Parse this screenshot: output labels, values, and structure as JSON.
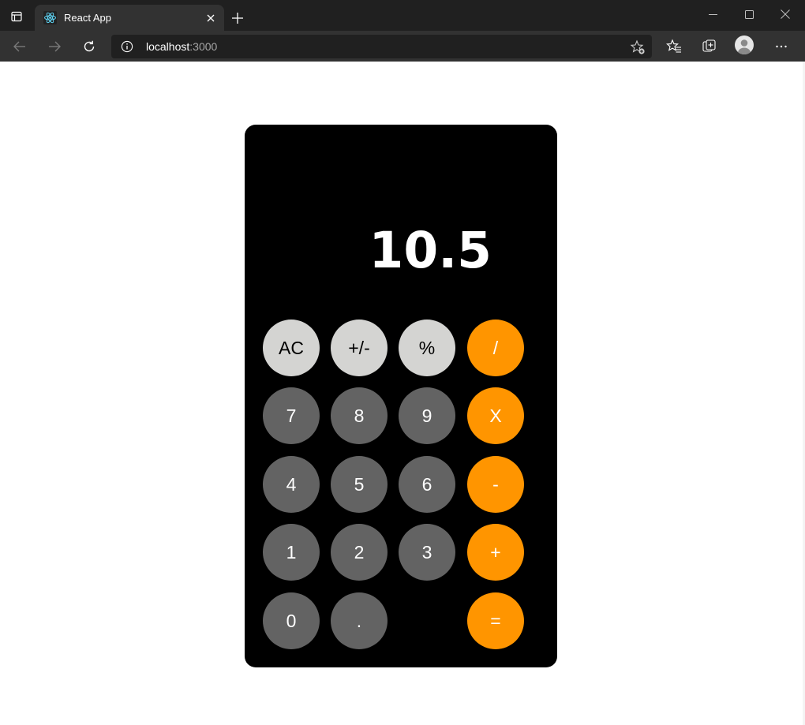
{
  "browser": {
    "tab_title": "React App",
    "url_host": "localhost",
    "url_port": ":3000"
  },
  "colors": {
    "function_key": "#d4d4d2",
    "number_key": "#636363",
    "operator_key": "#ff9500",
    "calculator_body": "#000000"
  },
  "calculator": {
    "display": "10.5",
    "keys": {
      "ac": "AC",
      "sign": "+/-",
      "percent": "%",
      "divide": "/",
      "seven": "7",
      "eight": "8",
      "nine": "9",
      "multiply": "X",
      "four": "4",
      "five": "5",
      "six": "6",
      "minus": "-",
      "one": "1",
      "two": "2",
      "three": "3",
      "plus": "+",
      "zero": "0",
      "dot": ".",
      "equals": "="
    }
  }
}
